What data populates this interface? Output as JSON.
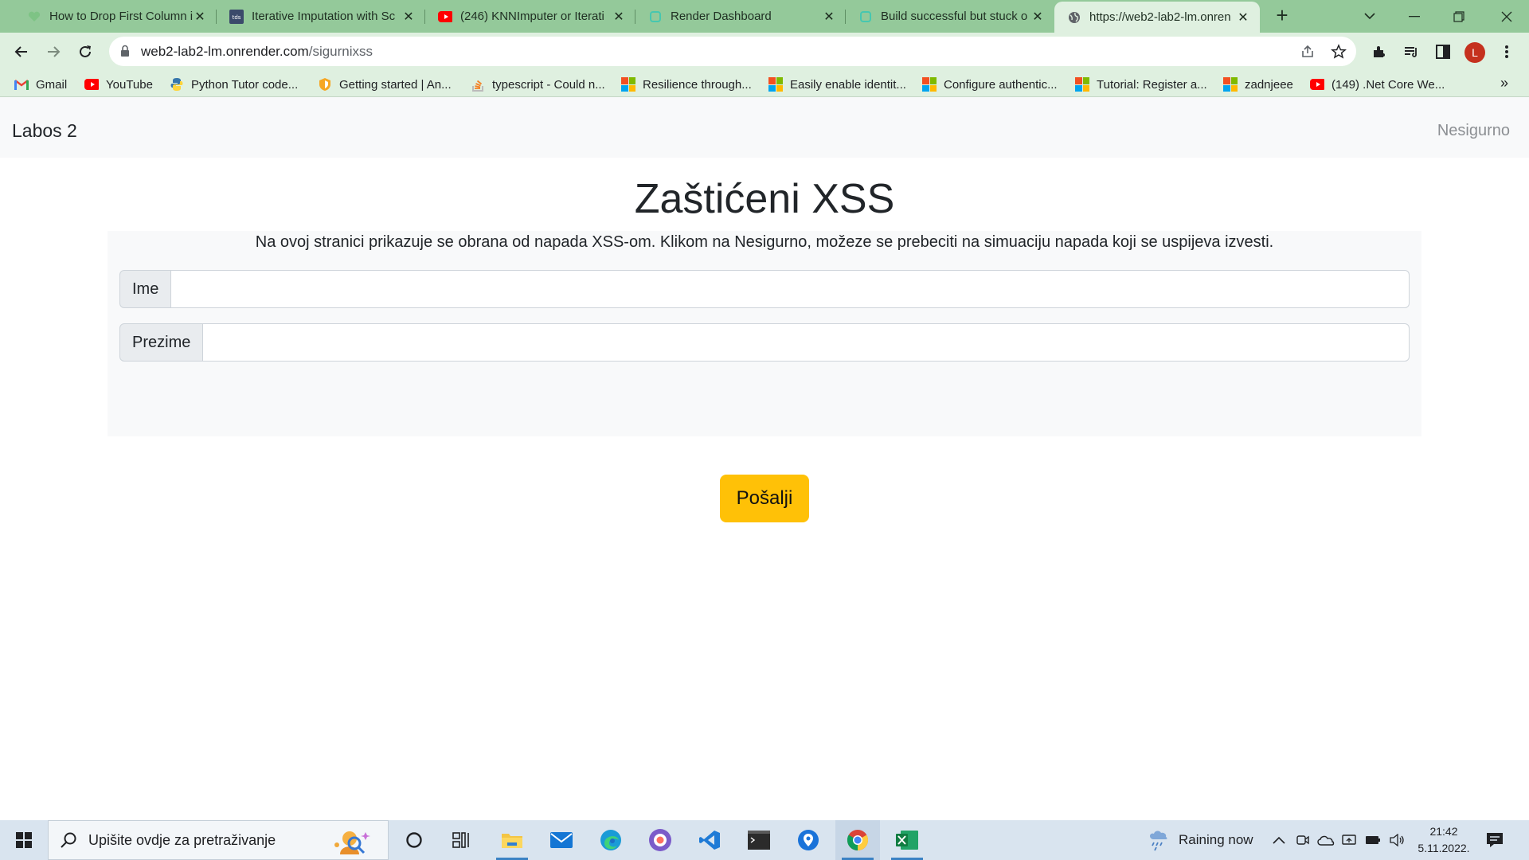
{
  "browser": {
    "tabs": [
      {
        "title": "How to Drop First Column i",
        "icon": "heart-favicon",
        "active": false
      },
      {
        "title": "Iterative Imputation with Sc",
        "icon": "tds-favicon",
        "active": false
      },
      {
        "title": "(246) KNNImputer or Iterati",
        "icon": "youtube-favicon",
        "active": false
      },
      {
        "title": "Render Dashboard",
        "icon": "render-favicon",
        "active": false
      },
      {
        "title": "Build successful but stuck o",
        "icon": "render-favicon",
        "active": false
      },
      {
        "title": "https://web2-lab2-lm.onren",
        "icon": "globe-favicon",
        "active": true
      }
    ],
    "new_tab": "+",
    "url_host": "web2-lab2-lm.onrender.com",
    "url_path": "/sigurnixss",
    "profile_initial": "L",
    "bookmarks": [
      {
        "label": "Gmail",
        "icon": "gmail-icon"
      },
      {
        "label": "YouTube",
        "icon": "youtube-icon"
      },
      {
        "label": "Python Tutor code...",
        "icon": "python-icon"
      },
      {
        "label": "Getting started | An...",
        "icon": "shield-icon"
      },
      {
        "label": "typescript - Could n...",
        "icon": "stackoverflow-icon"
      },
      {
        "label": "Resilience through...",
        "icon": "microsoft-icon"
      },
      {
        "label": "Easily enable identit...",
        "icon": "microsoft-icon"
      },
      {
        "label": "Configure authentic...",
        "icon": "microsoft-icon"
      },
      {
        "label": "Tutorial: Register a...",
        "icon": "microsoft-icon"
      },
      {
        "label": "zadnjeee",
        "icon": "microsoft-icon"
      },
      {
        "label": "(149) .Net Core We...",
        "icon": "youtube-icon"
      }
    ],
    "bookmarks_more": "»"
  },
  "page": {
    "brand": "Labos 2",
    "nav_link": "Nesigurno",
    "title": "Zaštićeni XSS",
    "description": "Na ovoj stranici prikazuje se obrana od napada XSS-om. Klikom na Nesigurno, možeze se prebeciti na simuaciju napada koji se uspijeva izvesti.",
    "form": {
      "first_name_label": "Ime",
      "first_name_value": "",
      "last_name_label": "Prezime",
      "last_name_value": "",
      "submit_label": "Pošalji"
    },
    "colors": {
      "button": "#ffc107",
      "navbar": "#f8f9fa"
    }
  },
  "taskbar": {
    "search_placeholder": "Upišite ovdje za pretraživanje",
    "weather": "Raining now",
    "time": "21:42",
    "date": "5.11.2022."
  }
}
